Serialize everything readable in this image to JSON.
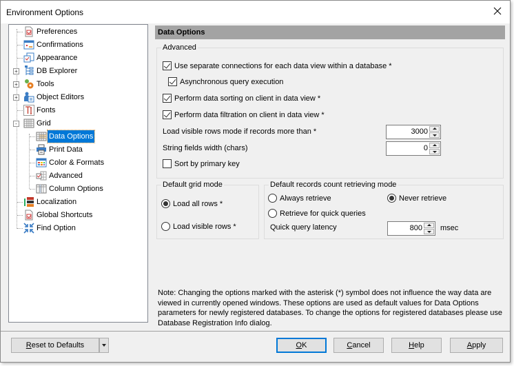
{
  "window": {
    "title": "Environment Options"
  },
  "tree": {
    "items": [
      {
        "label": "Preferences",
        "icon": "preferences-icon",
        "level": 0,
        "expander": null
      },
      {
        "label": "Confirmations",
        "icon": "confirmations-icon",
        "level": 0,
        "expander": null
      },
      {
        "label": "Appearance",
        "icon": "appearance-icon",
        "level": 0,
        "expander": null
      },
      {
        "label": "DB Explorer",
        "icon": "db-explorer-icon",
        "level": 0,
        "expander": "+"
      },
      {
        "label": "Tools",
        "icon": "tools-icon",
        "level": 0,
        "expander": "+"
      },
      {
        "label": "Object Editors",
        "icon": "object-editors-icon",
        "level": 0,
        "expander": "+"
      },
      {
        "label": "Fonts",
        "icon": "fonts-icon",
        "level": 0,
        "expander": null
      },
      {
        "label": "Grid",
        "icon": "grid-icon",
        "level": 0,
        "expander": "-"
      },
      {
        "label": "Data Options",
        "icon": "data-options-icon",
        "level": 1,
        "expander": null,
        "selected": true
      },
      {
        "label": "Print Data",
        "icon": "printer-icon",
        "level": 1,
        "expander": null
      },
      {
        "label": "Color & Formats",
        "icon": "color-formats-icon",
        "level": 1,
        "expander": null
      },
      {
        "label": "Advanced",
        "icon": "advanced-icon",
        "level": 1,
        "expander": null
      },
      {
        "label": "Column Options",
        "icon": "column-options-icon",
        "level": 1,
        "expander": null
      },
      {
        "label": "Localization",
        "icon": "localization-icon",
        "level": 0,
        "expander": null
      },
      {
        "label": "Global Shortcuts",
        "icon": "global-shortcuts-icon",
        "level": 0,
        "expander": null
      },
      {
        "label": "Find Option",
        "icon": "find-option-icon",
        "level": 0,
        "expander": null
      }
    ]
  },
  "panel": {
    "header": "Data Options",
    "advanced": {
      "legend": "Advanced",
      "separate_connections": {
        "label": "Use separate connections for each data view within a database *",
        "checked": true
      },
      "async_query": {
        "label": "Asynchronous query execution",
        "checked": true
      },
      "client_sorting": {
        "label": "Perform data sorting on client in data view *",
        "checked": true
      },
      "client_filtration": {
        "label": "Perform data filtration on client in data view *",
        "checked": true
      },
      "visible_rows_threshold": {
        "label": "Load visible rows mode if records more than *",
        "value": "3000"
      },
      "string_width": {
        "label": "String fields width (chars)",
        "value": "0"
      },
      "sort_primary_key": {
        "label": "Sort by primary key",
        "checked": false
      }
    },
    "grid_mode": {
      "legend": "Default grid mode",
      "load_all": {
        "label": "Load all rows *",
        "checked": true
      },
      "load_visible": {
        "label": "Load visible rows *",
        "checked": false
      }
    },
    "records_count": {
      "legend": "Default records count retrieving mode",
      "always": {
        "label": "Always retrieve",
        "checked": false
      },
      "never": {
        "label": "Never retrieve",
        "checked": true
      },
      "quick": {
        "label": "Retrieve for quick queries",
        "checked": false
      },
      "latency": {
        "label": "Quick query latency",
        "value": "800",
        "unit": "msec"
      }
    },
    "note": "Note: Changing the options marked with the asterisk (*) symbol does not influence the way data are viewed in currently opened windows. These options are used as default values for Data Options parameters for newly registered databases. To change the options for registered databases please use Database Registration Info dialog."
  },
  "footer": {
    "reset": {
      "accel": "R",
      "rest": "eset to Defaults"
    },
    "ok": {
      "accel": "O",
      "rest": "K"
    },
    "cancel": {
      "accel": "C",
      "rest": "ancel"
    },
    "help": {
      "accel": "H",
      "rest": "elp"
    },
    "apply": {
      "accel": "A",
      "rest": "pply"
    }
  },
  "colors": {
    "selection": "#0078d7",
    "header_bar": "#a3a3a3",
    "default_button_border": "#0078d7"
  }
}
